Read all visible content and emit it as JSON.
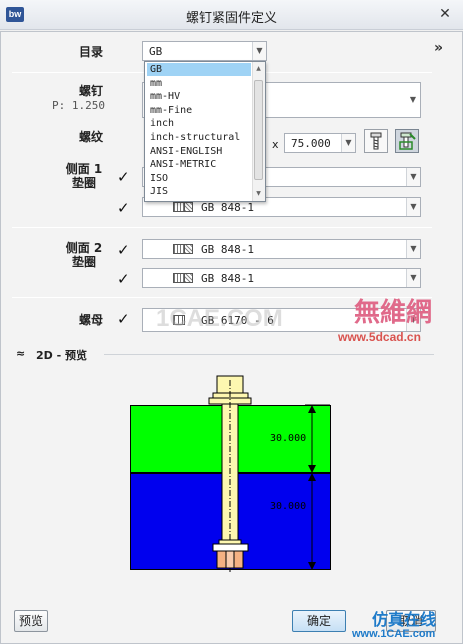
{
  "window": {
    "logo": "bw",
    "title": "螺钉紧固件定义",
    "close": "✕",
    "expand": "»"
  },
  "catalog": {
    "label": "目录",
    "value": "GB",
    "options": [
      "GB",
      "mm",
      "mm-HV",
      "mm-Fine",
      "inch",
      "inch-structural",
      "ANSI-ENGLISH",
      "ANSI-METRIC",
      "ISO",
      "JIS"
    ]
  },
  "screw": {
    "label": "螺钉",
    "pitch": "P: 1.250"
  },
  "thread": {
    "label": "螺纹",
    "x": "x",
    "length": "75.000"
  },
  "side1": {
    "label_line1": "侧面 1",
    "label_line2": "垫圈",
    "washer1": "",
    "washer2": "GB 848-1"
  },
  "side2": {
    "label_line1": "侧面 2",
    "label_line2": "垫圈",
    "washer1": "GB 848-1",
    "washer2": "GB 848-1"
  },
  "nut": {
    "label": "螺母",
    "value": "GB 6170 - 6"
  },
  "preview": {
    "title": "2D - 预览",
    "toggle": "≈",
    "dim_top": "30.000",
    "dim_bottom": "30.000",
    "colors": {
      "top_plate": "#00ff00",
      "bottom_plate": "#0000ee",
      "bolt": "#fdf7b0",
      "nut_orange": "#f4b183"
    }
  },
  "buttons": {
    "preview": "预览",
    "ok": "确定",
    "cancel": "取消"
  },
  "watermarks": {
    "cn_logo": "無維網",
    "url1": "www.5dcad.cn",
    "url2": "www.1CAE.com",
    "mark": "1CAE.COM",
    "cn_logo2": "仿真在线"
  }
}
